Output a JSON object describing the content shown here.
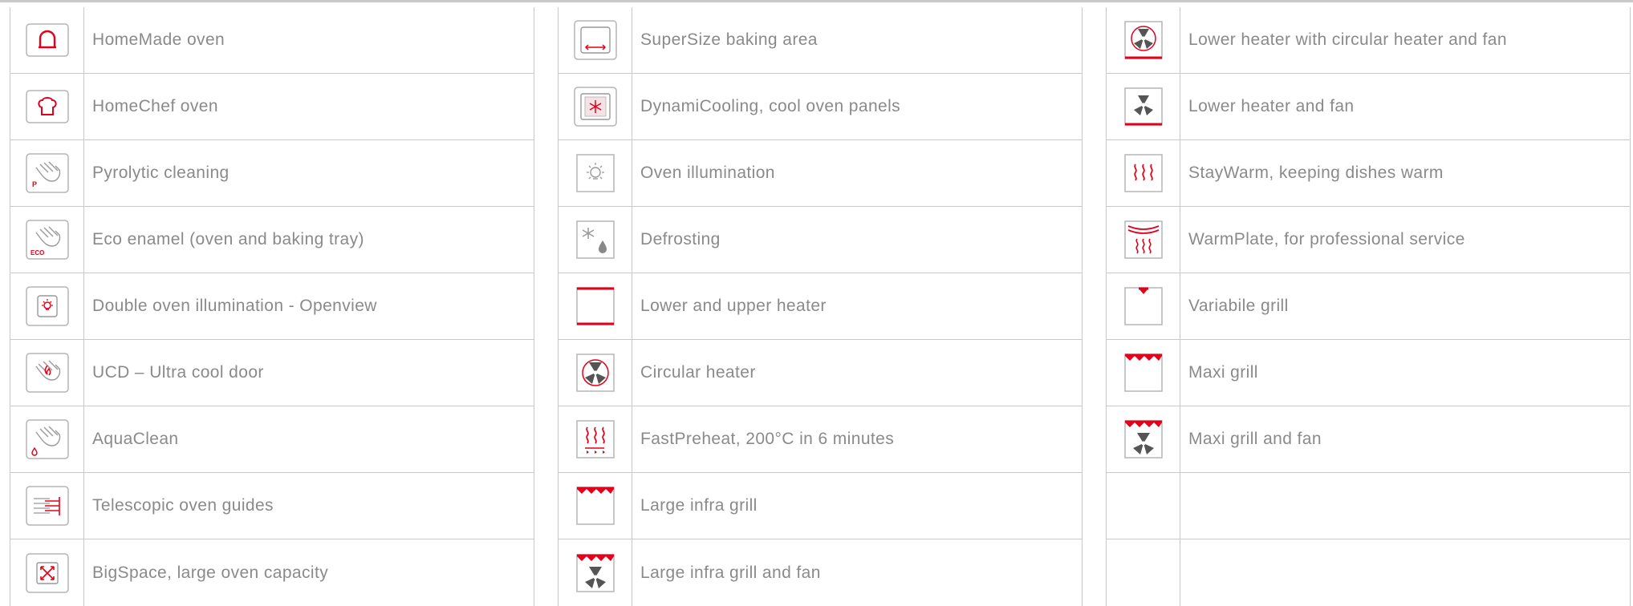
{
  "columns": [
    {
      "items": [
        {
          "icon": "homemade-oven-icon",
          "label": "HomeMade oven"
        },
        {
          "icon": "homechef-oven-icon",
          "label": "HomeChef oven"
        },
        {
          "icon": "pyrolytic-cleaning-icon",
          "label": "Pyrolytic cleaning"
        },
        {
          "icon": "eco-enamel-icon",
          "label": "Eco enamel (oven and baking tray)"
        },
        {
          "icon": "double-illumination-icon",
          "label": "Double oven illumination - Openview"
        },
        {
          "icon": "ultra-cool-door-icon",
          "label": "UCD – Ultra cool door"
        },
        {
          "icon": "aquaclean-icon",
          "label": "AquaClean"
        },
        {
          "icon": "telescopic-guides-icon",
          "label": "Telescopic oven guides"
        },
        {
          "icon": "bigspace-icon",
          "label": "BigSpace, large oven capacity"
        }
      ]
    },
    {
      "items": [
        {
          "icon": "supersize-baking-icon",
          "label": "SuperSize baking area"
        },
        {
          "icon": "dynamicooling-icon",
          "label": "DynamiCooling, cool oven panels"
        },
        {
          "icon": "oven-illumination-icon",
          "label": "Oven illumination"
        },
        {
          "icon": "defrosting-icon",
          "label": "Defrosting"
        },
        {
          "icon": "lower-upper-heater-icon",
          "label": "Lower and upper heater"
        },
        {
          "icon": "circular-heater-icon",
          "label": "Circular heater"
        },
        {
          "icon": "fastpreheat-icon",
          "label": "FastPreheat, 200°C in 6 minutes"
        },
        {
          "icon": "large-infra-grill-icon",
          "label": "Large infra grill"
        },
        {
          "icon": "large-infra-grill-fan-icon",
          "label": "Large infra grill and fan"
        }
      ]
    },
    {
      "items": [
        {
          "icon": "lower-heater-circular-fan-icon",
          "label": "Lower heater with circular heater and fan"
        },
        {
          "icon": "lower-heater-fan-icon",
          "label": "Lower heater and fan"
        },
        {
          "icon": "staywarm-icon",
          "label": "StayWarm, keeping dishes warm"
        },
        {
          "icon": "warmplate-icon",
          "label": "WarmPlate, for professional service"
        },
        {
          "icon": "variable-grill-icon",
          "label": "Variabile grill"
        },
        {
          "icon": "maxi-grill-icon",
          "label": "Maxi grill"
        },
        {
          "icon": "maxi-grill-fan-icon",
          "label": "Maxi grill and fan"
        },
        {
          "icon": "",
          "label": ""
        },
        {
          "icon": "",
          "label": ""
        }
      ]
    }
  ],
  "colors": {
    "accent": "#e2001a",
    "grid": "#c9c9c9",
    "text": "#8a8a8a",
    "icon_gray": "#555555"
  }
}
